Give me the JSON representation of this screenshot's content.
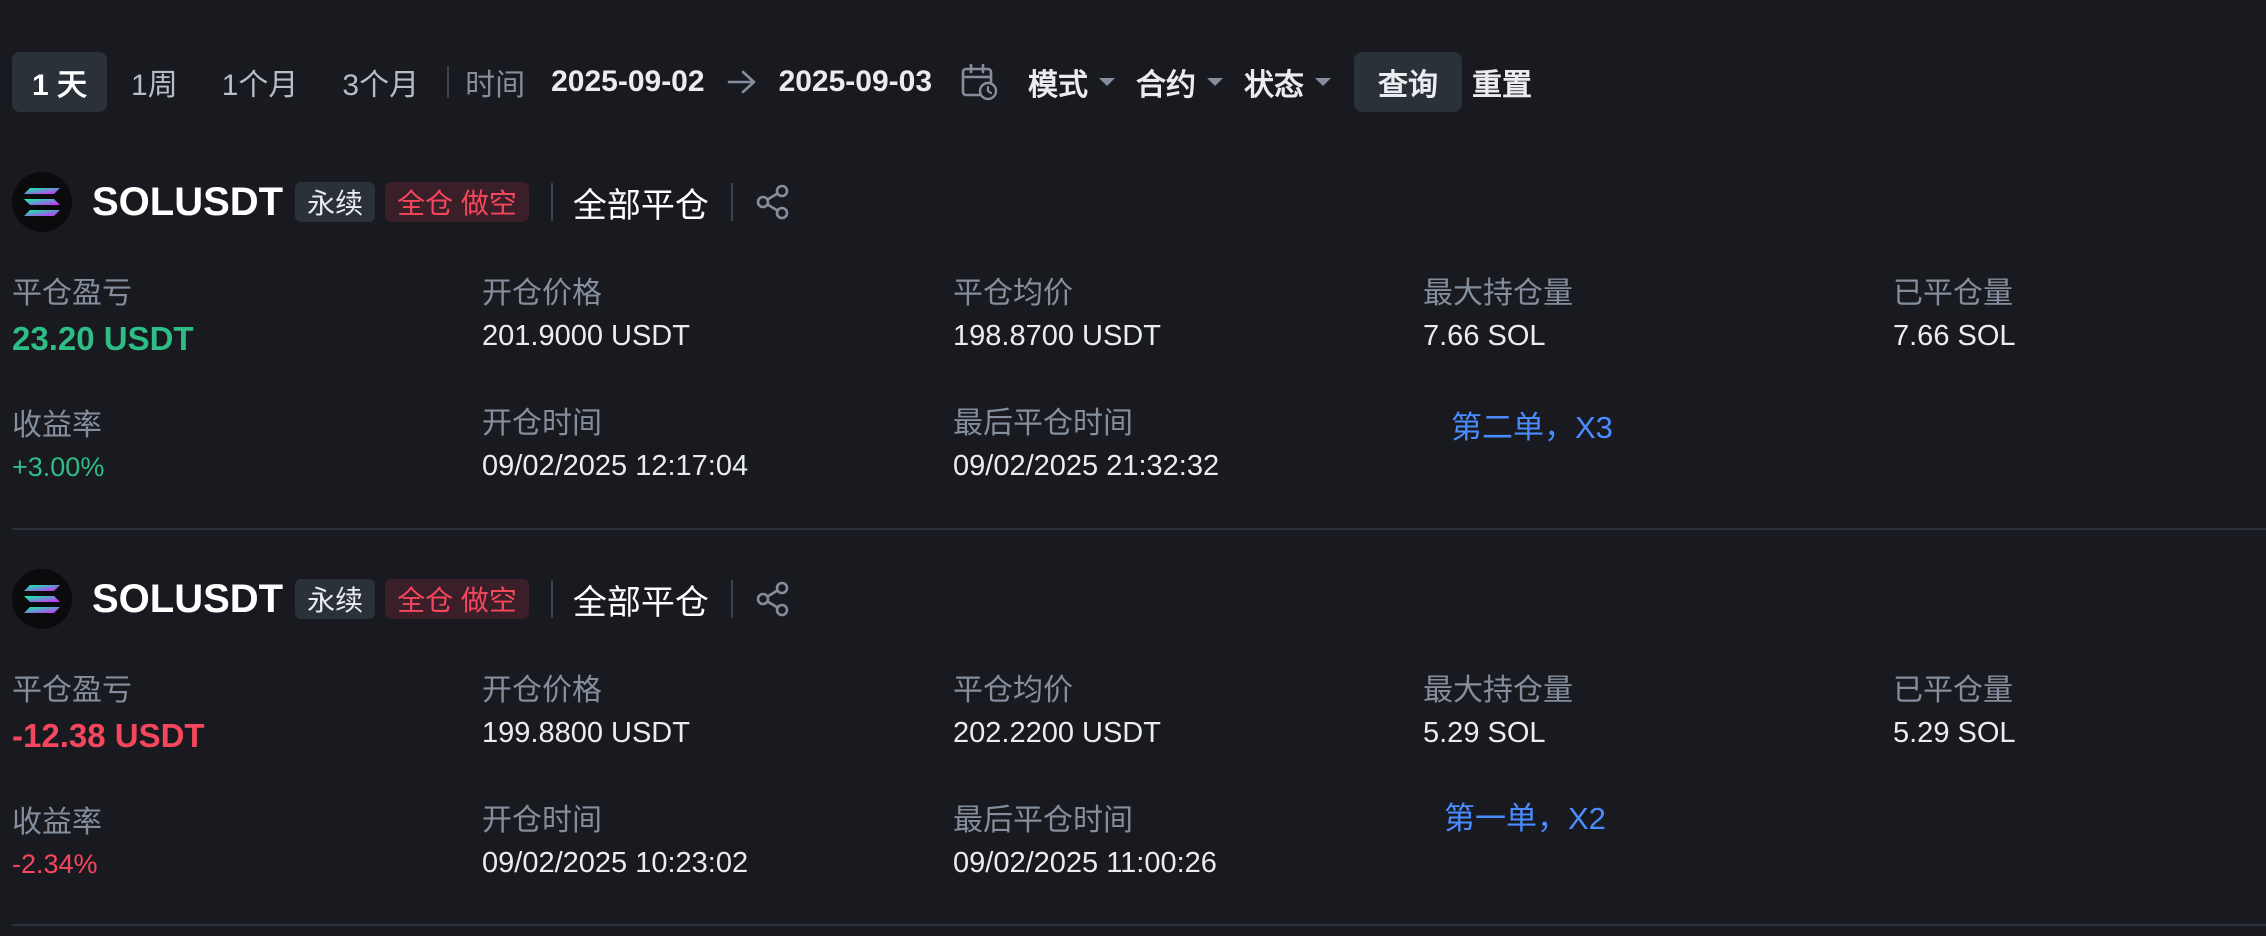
{
  "filter": {
    "periods": [
      "1 天",
      "1周",
      "1个月",
      "3个月"
    ],
    "time_label": "时间",
    "start_date": "2025-09-02",
    "end_date": "2025-09-03",
    "mode_label": "模式",
    "contract_label": "合约",
    "status_label": "状态",
    "query_label": "查询",
    "reset_label": "重置"
  },
  "labels": {
    "pnl": "平仓盈亏",
    "roi": "收益率",
    "entry_price": "开仓价格",
    "open_time": "开仓时间",
    "avg_close_price": "平仓均价",
    "last_close_time": "最后平仓时间",
    "max_position": "最大持仓量",
    "closed_qty": "已平仓量"
  },
  "positions": [
    {
      "symbol": "SOLUSDT",
      "type_tag": "永续",
      "side_tag": "全仓 做空",
      "close_type": "全部平仓",
      "pnl": "23.20 USDT",
      "roi": "+3.00%",
      "entry_price": "201.9000 USDT",
      "open_time": "09/02/2025 12:17:04",
      "avg_close_price": "198.8700 USDT",
      "last_close_time": "09/02/2025 21:32:32",
      "max_position": "7.66 SOL",
      "closed_qty": "7.66 SOL",
      "note": "第二单，X3"
    },
    {
      "symbol": "SOLUSDT",
      "type_tag": "永续",
      "side_tag": "全仓 做空",
      "close_type": "全部平仓",
      "pnl": "-12.38 USDT",
      "roi": "-2.34%",
      "entry_price": "199.8800 USDT",
      "open_time": "09/02/2025 10:23:02",
      "avg_close_price": "202.2200 USDT",
      "last_close_time": "09/02/2025 11:00:26",
      "max_position": "5.29 SOL",
      "closed_qty": "5.29 SOL",
      "note": "第一单，X2"
    }
  ],
  "colors": {
    "background": "#181a20",
    "positive": "#2ebd85",
    "negative": "#f6465d",
    "annotation": "#4a8cff"
  }
}
